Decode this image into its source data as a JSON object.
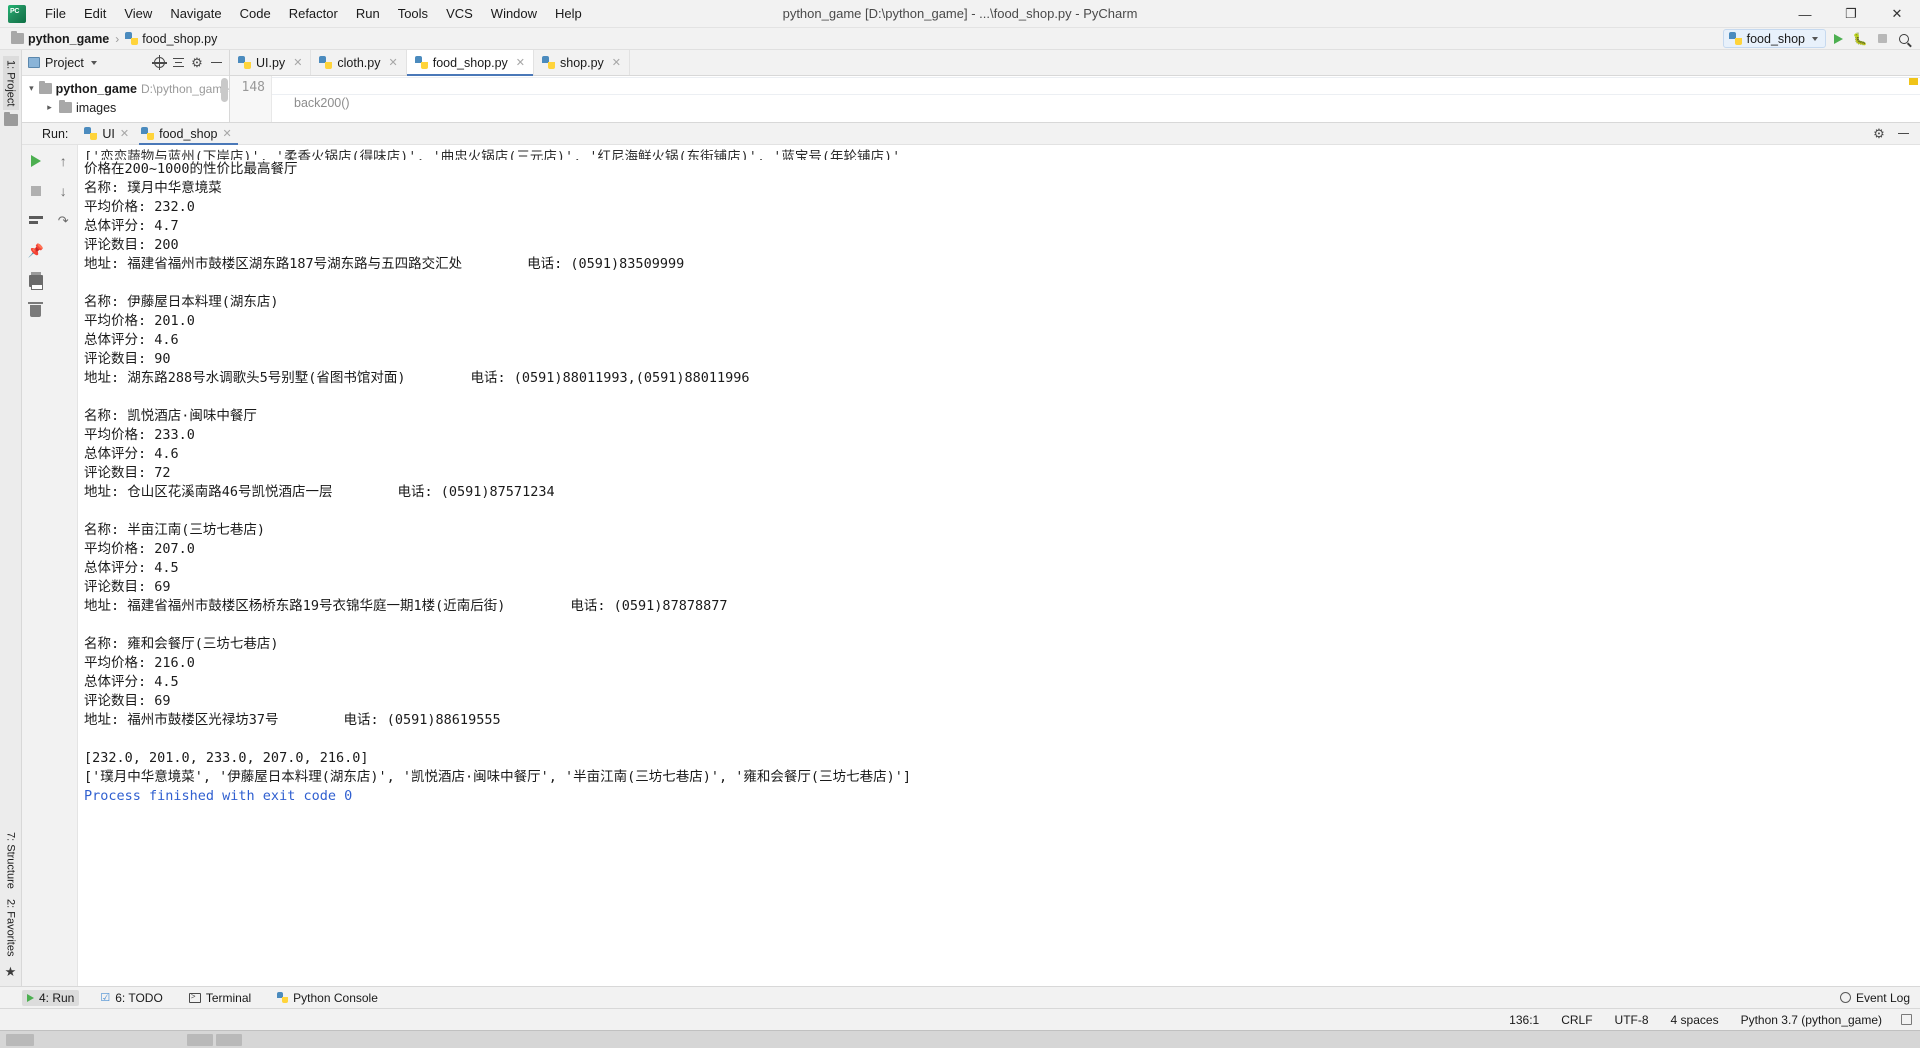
{
  "window": {
    "title": "python_game [D:\\python_game] - ...\\food_shop.py - PyCharm",
    "minimize": "—",
    "maximize": "❐",
    "close": "✕"
  },
  "menubar": {
    "items": [
      "File",
      "Edit",
      "View",
      "Navigate",
      "Code",
      "Refactor",
      "Run",
      "Tools",
      "VCS",
      "Window",
      "Help"
    ]
  },
  "breadcrumb": {
    "project": "python_game",
    "separator": "›",
    "file": "food_shop.py"
  },
  "toolbar": {
    "run_config": "food_shop",
    "run_tooltip": "Run",
    "debug_tooltip": "Debug",
    "stop_tooltip": "Stop",
    "search_tooltip": "Search Everywhere"
  },
  "left_strip": {
    "project_tab": "1: Project",
    "structure_tab": "7: Structure",
    "favorites_tab": "2: Favorites"
  },
  "project_panel": {
    "title": "Project",
    "actions": [
      "target-icon",
      "collapse-all-icon",
      "gear-icon",
      "hide-icon"
    ],
    "tree": [
      {
        "name": "python_game",
        "path": "D:\\python_game",
        "expanded": true,
        "bold": true,
        "indent": 0
      },
      {
        "name": "images",
        "path": "",
        "expanded": false,
        "bold": false,
        "indent": 1
      }
    ]
  },
  "editor": {
    "tabs": [
      {
        "label": "UI.py",
        "active": false
      },
      {
        "label": "cloth.py",
        "active": false
      },
      {
        "label": "food_shop.py",
        "active": true
      },
      {
        "label": "shop.py",
        "active": false
      }
    ],
    "line_number": "148",
    "code_breadcrumb": "back200()"
  },
  "run_panel": {
    "label": "Run:",
    "tabs": [
      {
        "label": "UI",
        "active": false
      },
      {
        "label": "food_shop",
        "active": true
      }
    ],
    "side_icons": [
      "run-icon",
      "stop-icon",
      "rerun-icon",
      "scroll-up-icon",
      "scroll-down-icon",
      "soft-wrap-icon",
      "pin-icon",
      "print-icon",
      "clear-all-icon"
    ],
    "console_clipped_line": "['恋恋蔬物与蓝州(下岸店)', '柔香火锅店(得味店)', '曲忠火锅店(三元店)', '红尼海鲜火锅(东街铺店)', '蓝宝号(年轮铺店)'",
    "console_output": "价格在200~1000的性价比最高餐厅\n名称: 璞月中华意境菜\n平均价格: 232.0\n总体评分: 4.7\n评论数目: 200\n地址: 福建省福州市鼓楼区湖东路187号湖东路与五四路交汇处        电话: (0591)83509999\n\n名称: 伊藤屋日本料理(湖东店)\n平均价格: 201.0\n总体评分: 4.6\n评论数目: 90\n地址: 湖东路288号水调歌头5号别墅(省图书馆对面)        电话: (0591)88011993,(0591)88011996\n\n名称: 凯悦酒店·闽味中餐厅\n平均价格: 233.0\n总体评分: 4.6\n评论数目: 72\n地址: 仓山区花溪南路46号凯悦酒店一层        电话: (0591)87571234\n\n名称: 半亩江南(三坊七巷店)\n平均价格: 207.0\n总体评分: 4.5\n评论数目: 69\n地址: 福建省福州市鼓楼区杨桥东路19号衣锦华庭一期1楼(近南后街)        电话: (0591)87878877\n\n名称: 雍和会餐厅(三坊七巷店)\n平均价格: 216.0\n总体评分: 4.5\n评论数目: 69\n地址: 福州市鼓楼区光禄坊37号        电话: (0591)88619555\n\n[232.0, 201.0, 233.0, 207.0, 216.0]\n['璞月中华意境菜', '伊藤屋日本料理(湖东店)', '凯悦酒店·闽味中餐厅', '半亩江南(三坊七巷店)', '雍和会餐厅(三坊七巷店)']\n",
    "exit_message": "Process finished with exit code 0"
  },
  "results": {
    "header": "价格在200~1000的性价比最高餐厅",
    "restaurants": [
      {
        "name_label": "名称:",
        "name": "璞月中华意境菜",
        "price_label": "平均价格:",
        "price": "232.0",
        "score_label": "总体评分:",
        "score": "4.7",
        "reviews_label": "评论数目:",
        "reviews": "200",
        "address_label": "地址:",
        "address": "福建省福州市鼓楼区湖东路187号湖东路与五四路交汇处",
        "phone_label": "电话:",
        "phone": "(0591)83509999"
      },
      {
        "name_label": "名称:",
        "name": "伊藤屋日本料理(湖东店)",
        "price_label": "平均价格:",
        "price": "201.0",
        "score_label": "总体评分:",
        "score": "4.6",
        "reviews_label": "评论数目:",
        "reviews": "90",
        "address_label": "地址:",
        "address": "湖东路288号水调歌头5号别墅(省图书馆对面)",
        "phone_label": "电话:",
        "phone": "(0591)88011993,(0591)88011996"
      },
      {
        "name_label": "名称:",
        "name": "凯悦酒店·闽味中餐厅",
        "price_label": "平均价格:",
        "price": "233.0",
        "score_label": "总体评分:",
        "score": "4.6",
        "reviews_label": "评论数目:",
        "reviews": "72",
        "address_label": "地址:",
        "address": "仓山区花溪南路46号凯悦酒店一层",
        "phone_label": "电话:",
        "phone": "(0591)87571234"
      },
      {
        "name_label": "名称:",
        "name": "半亩江南(三坊七巷店)",
        "price_label": "平均价格:",
        "price": "207.0",
        "score_label": "总体评分:",
        "score": "4.5",
        "reviews_label": "评论数目:",
        "reviews": "69",
        "address_label": "地址:",
        "address": "福建省福州市鼓楼区杨桥东路19号衣锦华庭一期1楼(近南后街)",
        "phone_label": "电话:",
        "phone": "(0591)87878877"
      },
      {
        "name_label": "名称:",
        "name": "雍和会餐厅(三坊七巷店)",
        "price_label": "平均价格:",
        "price": "216.0",
        "score_label": "总体评分:",
        "score": "4.5",
        "reviews_label": "评论数目:",
        "reviews": "69",
        "address_label": "地址:",
        "address": "福州市鼓楼区光禄坊37号",
        "phone_label": "电话:",
        "phone": "(0591)88619555"
      }
    ],
    "price_list": "[232.0, 201.0, 233.0, 207.0, 216.0]",
    "name_list": "['璞月中华意境菜', '伊藤屋日本料理(湖东店)', '凯悦酒店·闽味中餐厅', '半亩江南(三坊七巷店)', '雍和会餐厅(三坊七巷店)']"
  },
  "bottom_bar": {
    "run": "4: Run",
    "todo": "6: TODO",
    "terminal": "Terminal",
    "python_console": "Python Console",
    "event_log": "Event Log"
  },
  "status_bar": {
    "caret": "136:1",
    "line_sep": "CRLF",
    "encoding": "UTF-8",
    "indent": "4 spaces",
    "interpreter": "Python 3.7 (python_game)"
  },
  "colors": {
    "accent": "#4a78b8",
    "run_green": "#4caf50",
    "link_blue": "#2f5fd0",
    "chrome": "#f2f2f2"
  }
}
